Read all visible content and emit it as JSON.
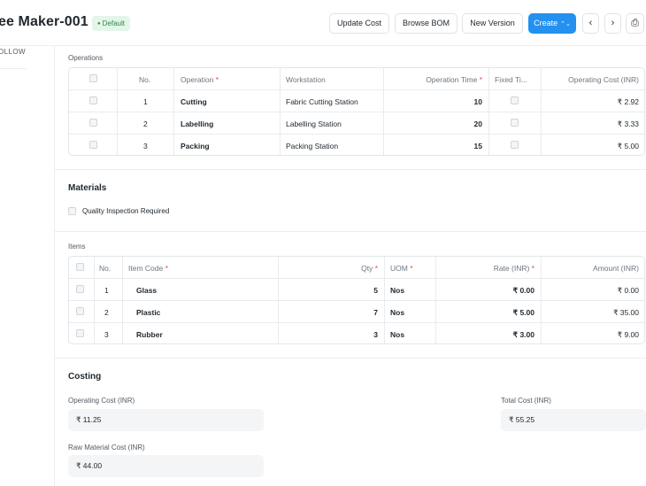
{
  "header": {
    "title": "ee Maker-001",
    "badge": "Default",
    "buttons": {
      "update_cost": "Update Cost",
      "browse_bom": "Browse BOM",
      "new_version": "New Version",
      "create": "Create",
      "prev": "‹",
      "next": "›",
      "print": "⎙"
    }
  },
  "sidebar": {
    "follow": "OLLOW"
  },
  "operations": {
    "label": "Operations",
    "headers": [
      "No.",
      "Operation",
      "Workstation",
      "Operation Time",
      "Fixed Ti...",
      "Operating Cost (INR)"
    ],
    "rows": [
      {
        "no": "1",
        "operation": "Cutting",
        "workstation": "Fabric Cutting Station",
        "time": "10",
        "cost": "₹ 2.92"
      },
      {
        "no": "2",
        "operation": "Labelling",
        "workstation": "Labelling Station",
        "time": "20",
        "cost": "₹ 3.33"
      },
      {
        "no": "3",
        "operation": "Packing",
        "workstation": "Packing Station",
        "time": "15",
        "cost": "₹ 5.00"
      }
    ]
  },
  "materials": {
    "heading": "Materials",
    "quality_inspection": "Quality Inspection Required",
    "items_label": "Items",
    "headers": [
      "No.",
      "Item Code",
      "Qty",
      "UOM",
      "Rate (INR)",
      "Amount (INR)"
    ],
    "rows": [
      {
        "no": "1",
        "item": "Glass",
        "qty": "5",
        "uom": "Nos",
        "rate": "₹ 0.00",
        "amount": "₹ 0.00"
      },
      {
        "no": "2",
        "item": "Plastic",
        "qty": "7",
        "uom": "Nos",
        "rate": "₹ 5.00",
        "amount": "₹ 35.00"
      },
      {
        "no": "3",
        "item": "Rubber",
        "qty": "3",
        "uom": "Nos",
        "rate": "₹ 3.00",
        "amount": "₹ 9.00"
      }
    ]
  },
  "costing": {
    "heading": "Costing",
    "operating_cost_label": "Operating Cost (INR)",
    "operating_cost_value": "₹ 11.25",
    "total_cost_label": "Total Cost (INR)",
    "total_cost_value": "₹ 55.25",
    "raw_material_cost_label": "Raw Material Cost (INR)",
    "raw_material_cost_value": "₹ 44.00"
  },
  "colors": {
    "primary": "#2490ef",
    "badge_bg": "#e4f5e9",
    "badge_text": "#2b8a4b",
    "field_bg": "#f4f5f6",
    "required": "#e24c4c"
  }
}
